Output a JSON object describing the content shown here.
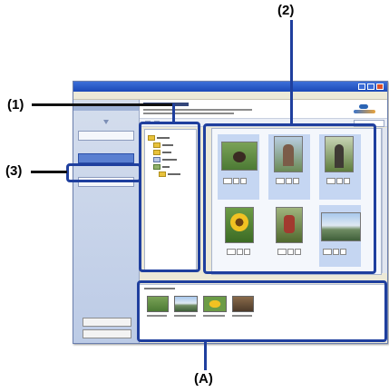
{
  "callouts": {
    "one": "(1)",
    "two": "(2)",
    "three": "(3)",
    "a": "(A)"
  },
  "colors": {
    "callout_line": "#1f3f9e",
    "titlebar": "#2a5ac8"
  },
  "window": {
    "title": "",
    "menu": [
      "",
      "",
      "",
      ""
    ]
  },
  "sidebar": {
    "step1": "",
    "step2": "",
    "step3": "",
    "help": "",
    "exit": ""
  },
  "queue": {
    "label": ""
  }
}
